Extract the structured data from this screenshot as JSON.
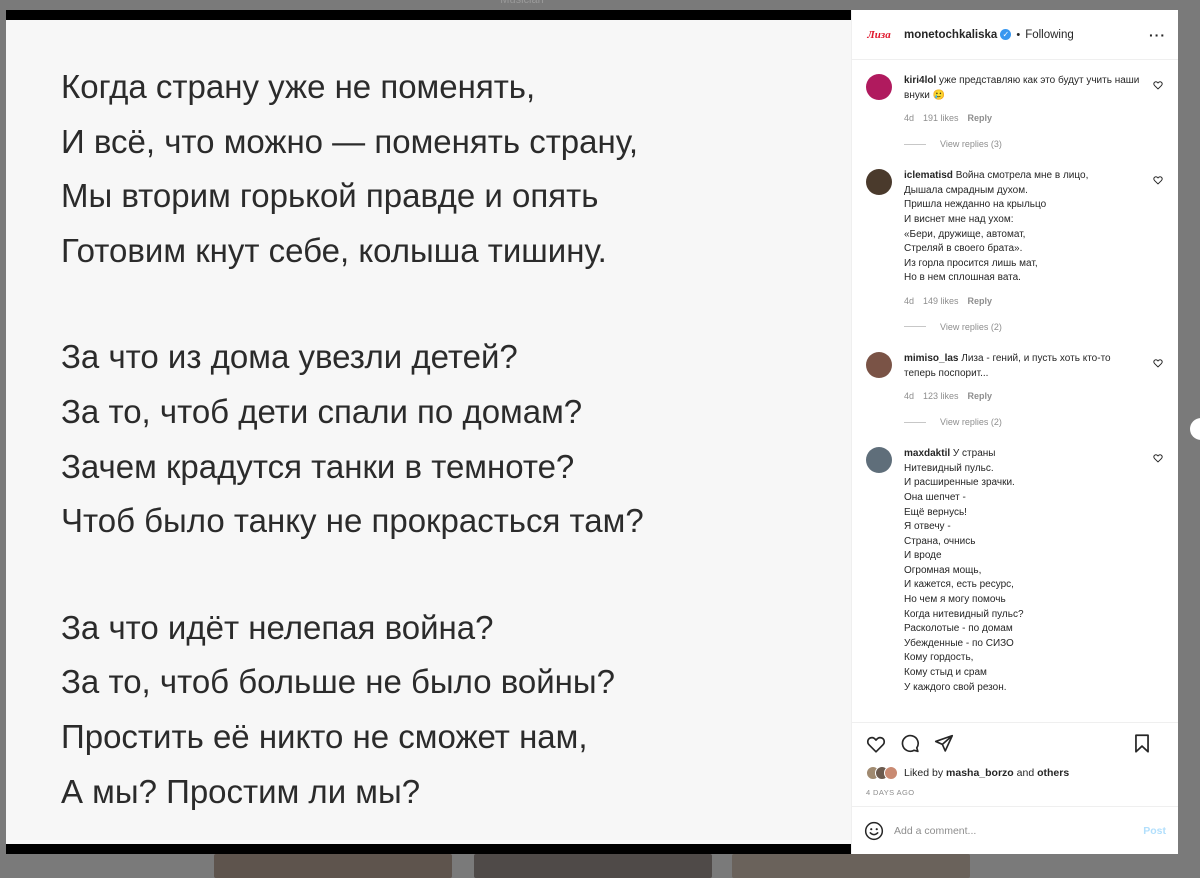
{
  "backdrop": {
    "label": "Musician"
  },
  "post": {
    "stanzas": [
      [
        "Когда страну уже не поменять,",
        "И всё, что можно — поменять страну,",
        "Мы вторим горькой правде и опять",
        "Готовим кнут себе, колыша тишину."
      ],
      [
        "За что из дома увезли детей?",
        "За то, чтоб дети спали по домам?",
        "Зачем крадутся танки в темноте?",
        "Чтоб было танку не прокрасться там?"
      ],
      [
        "За что идёт нелепая война?",
        "За то, чтоб больше не было войны?",
        "Простить её никто не сможет нам,",
        "А мы? Простим ли мы?"
      ]
    ]
  },
  "header": {
    "avatar_text": "Лиза",
    "username": "monetochkaliska",
    "verified_mark": "✓",
    "separator": "•",
    "follow_label": "Following",
    "more_label": "···"
  },
  "comments": [
    {
      "user": "kiri4lol",
      "text": "уже представляю как это будут учить наши внуки 🥲",
      "age": "4d",
      "likes": "191 likes",
      "reply": "Reply",
      "replies": "View replies (3)",
      "avatar_color": "#b01a5e"
    },
    {
      "user": "iclematisd",
      "text": "Война смотрела мне в лицо,\nДышала смрадным духом.\nПришла нежданно на крыльцо\nИ виснет мне над ухом:\n«Бери, дружище, автомат,\nСтреляй в своего брата».\nИз горла просится лишь мат,\nНо в нем сплошная вата.",
      "age": "4d",
      "likes": "149 likes",
      "reply": "Reply",
      "replies": "View replies (2)",
      "avatar_color": "#4a3a2c"
    },
    {
      "user": "mimiso_las",
      "text": "Лиза - гений, и пусть хоть кто-то теперь поспорит...",
      "age": "4d",
      "likes": "123 likes",
      "reply": "Reply",
      "replies": "View replies (2)",
      "avatar_color": "#7a5346"
    },
    {
      "user": "maxdaktil",
      "text": "У страны\nНитевидный пульс.\nИ расширенные зрачки.\nОна шепчет -\nЕщё вернусь!\nЯ отвечу -\nСтрана, очнись\nИ вроде\nОгромная мощь,\nИ кажется, есть ресурс,\nНо чем я могу помочь\nКогда нитевидный пульс?\nРасколотые - по домам\nУбежденные - по СИЗО\nКому гордость,\nКому стыд и срам\nУ каждого свой резон.",
      "age": "",
      "likes": "",
      "reply": "",
      "replies": "",
      "avatar_color": "#5f6e7a"
    }
  ],
  "footer": {
    "liked_prefix": "Liked by",
    "liked_user": "masha_borzo",
    "liked_and": "and",
    "liked_others": "others",
    "date": "4 DAYS AGO",
    "comment_placeholder": "Add a comment...",
    "post_label": "Post"
  },
  "colors": {
    "brand": "#e0182d",
    "verified": "#3897f0",
    "post_button": "#b2dffc"
  }
}
